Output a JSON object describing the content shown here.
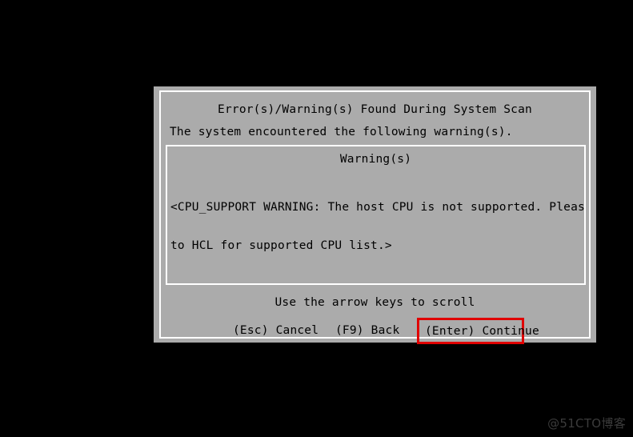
{
  "screen": {
    "background_color": "#000000"
  },
  "dialog": {
    "title": "Error(s)/Warning(s) Found During System Scan",
    "intro": "The system encountered the following warning(s).",
    "background_color": "#ababab",
    "border_color": "#ffffff",
    "text_color": "#000000",
    "panel": {
      "heading": "Warning(s)",
      "lines": [
        "<CPU_SUPPORT WARNING: The host CPU is not supported. Please refer",
        "to HCL for supported CPU list.>"
      ]
    },
    "scroll_hint": "Use the arrow keys to scroll",
    "actions": [
      {
        "label": "(Esc) Cancel",
        "key": "Esc",
        "highlighted": false
      },
      {
        "label": "(F9) Back",
        "key": "F9",
        "highlighted": false
      },
      {
        "label": "(Enter) Continue",
        "key": "Enter",
        "highlighted": true
      }
    ],
    "highlight_color": "#e00000"
  },
  "watermark": {
    "text": "@51CTO博客",
    "color": "#3b3b3b"
  }
}
